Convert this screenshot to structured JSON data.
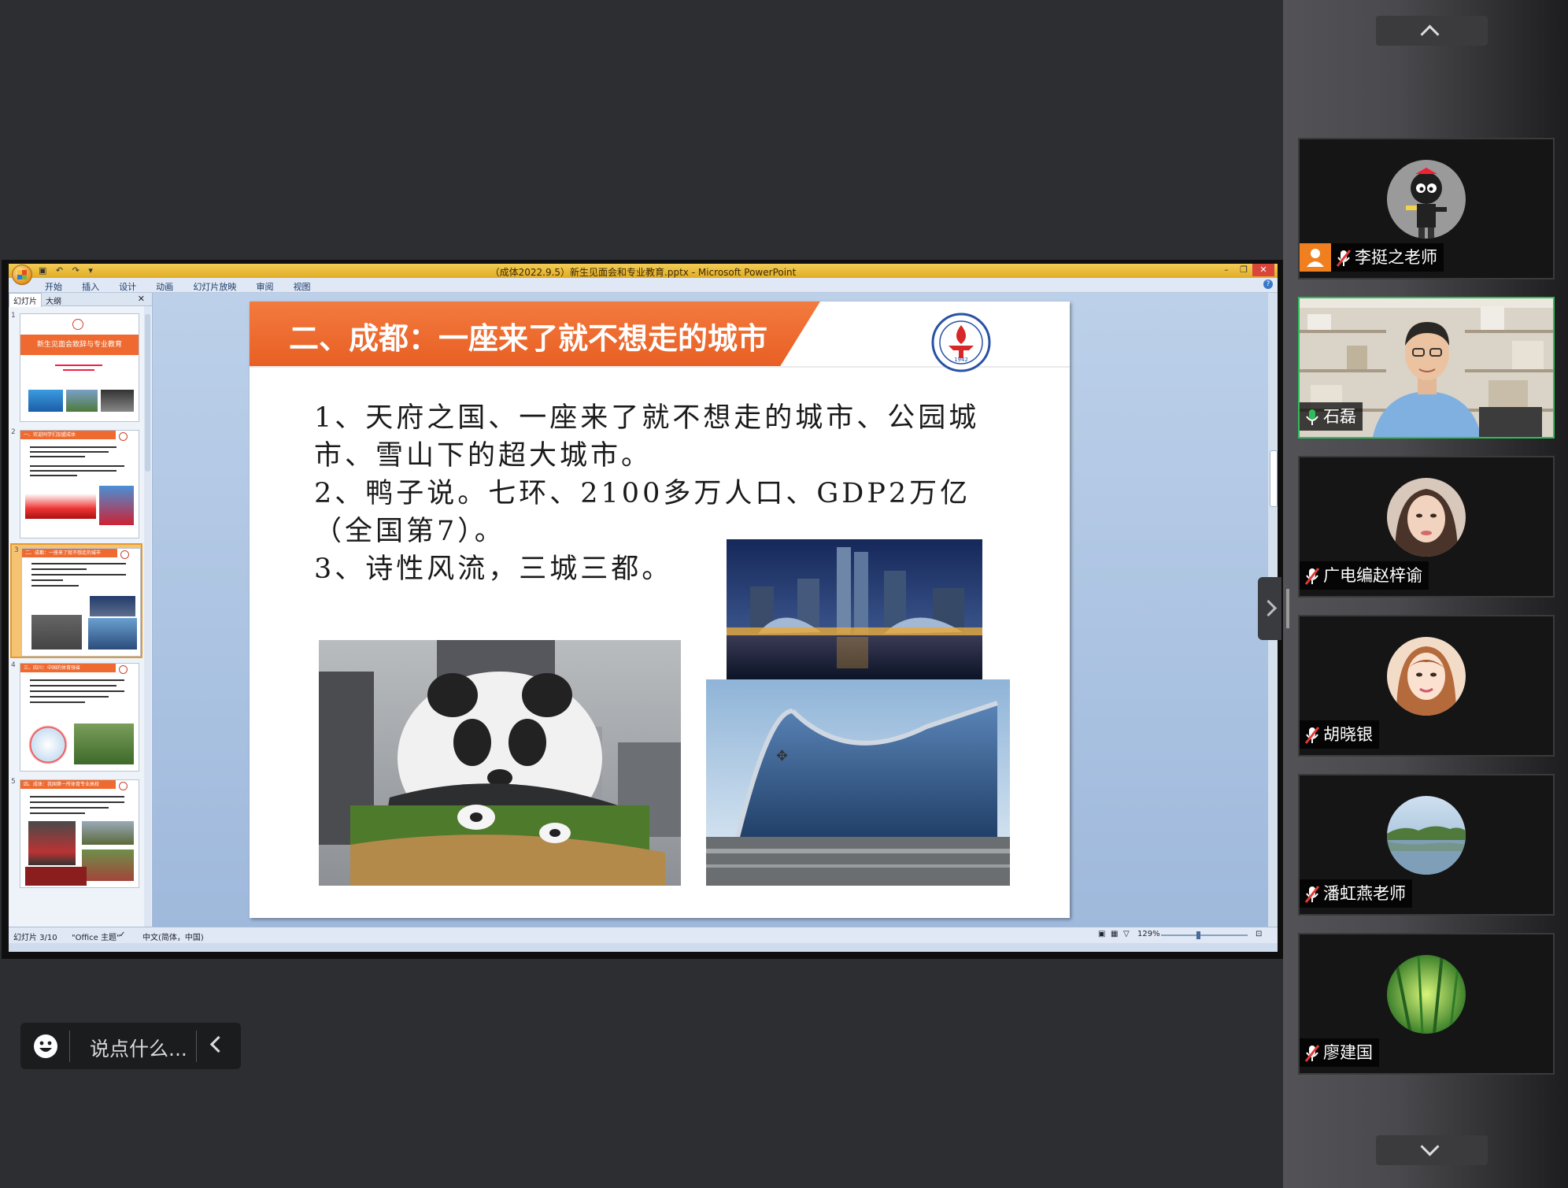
{
  "ppt": {
    "window_title": "（成体2022.9.5）新生见面会和专业教育.pptx - Microsoft PowerPoint",
    "qat": "▣ ↶ ↷ ▾",
    "ribbon_tabs": [
      "开始",
      "插入",
      "设计",
      "动画",
      "幻灯片放映",
      "审阅",
      "视图"
    ],
    "panel_tabs": [
      "幻灯片",
      "大纲"
    ],
    "status": {
      "slide": "幻灯片 3/10",
      "theme": "\"Office 主题\"",
      "lang": "中文(简体，中国)",
      "zoom": "129%"
    },
    "thumbs": [
      {
        "num": "1",
        "bar": "新生见面会致辞与专业教育"
      },
      {
        "num": "2",
        "bar": "一、欢迎同学们加盟成体"
      },
      {
        "num": "3",
        "bar": "二、成都：一座来了就不想走的城市"
      },
      {
        "num": "4",
        "bar": "三、四川：中国的体育强省"
      },
      {
        "num": "5",
        "bar": "四、成体：我国第一所体育专业高校"
      }
    ]
  },
  "slide": {
    "title": "二、成都：一座来了就不想走的城市",
    "lines": [
      "1、天府之国、一座来了就不想走的城市、公园城市、雪山下的超大城市。",
      "2、鸭子说。七环、2100多万人口、GDP2万亿（全国第7）。",
      "3、诗性风流，三城三都。"
    ],
    "logo_year": "1942"
  },
  "participants": [
    {
      "name": "李挺之老师",
      "host": true,
      "mic": "muted",
      "avatar": "cartoon"
    },
    {
      "name": "石磊",
      "host": false,
      "mic": "on",
      "avatar": "video"
    },
    {
      "name": "广电编赵梓谕",
      "host": false,
      "mic": "muted",
      "avatar": "woman1"
    },
    {
      "name": "胡晓银",
      "host": false,
      "mic": "muted",
      "avatar": "woman2"
    },
    {
      "name": "潘虹燕老师",
      "host": false,
      "mic": "muted",
      "avatar": "lake"
    },
    {
      "name": "廖建国",
      "host": false,
      "mic": "muted",
      "avatar": "bamboo"
    }
  ],
  "chat": {
    "placeholder": "说点什么..."
  },
  "colors": {
    "accent_orange": "#ee6a30",
    "active_green": "#2fbd5a",
    "muted_red": "#e53935",
    "mic_green": "#2fbd5a"
  }
}
